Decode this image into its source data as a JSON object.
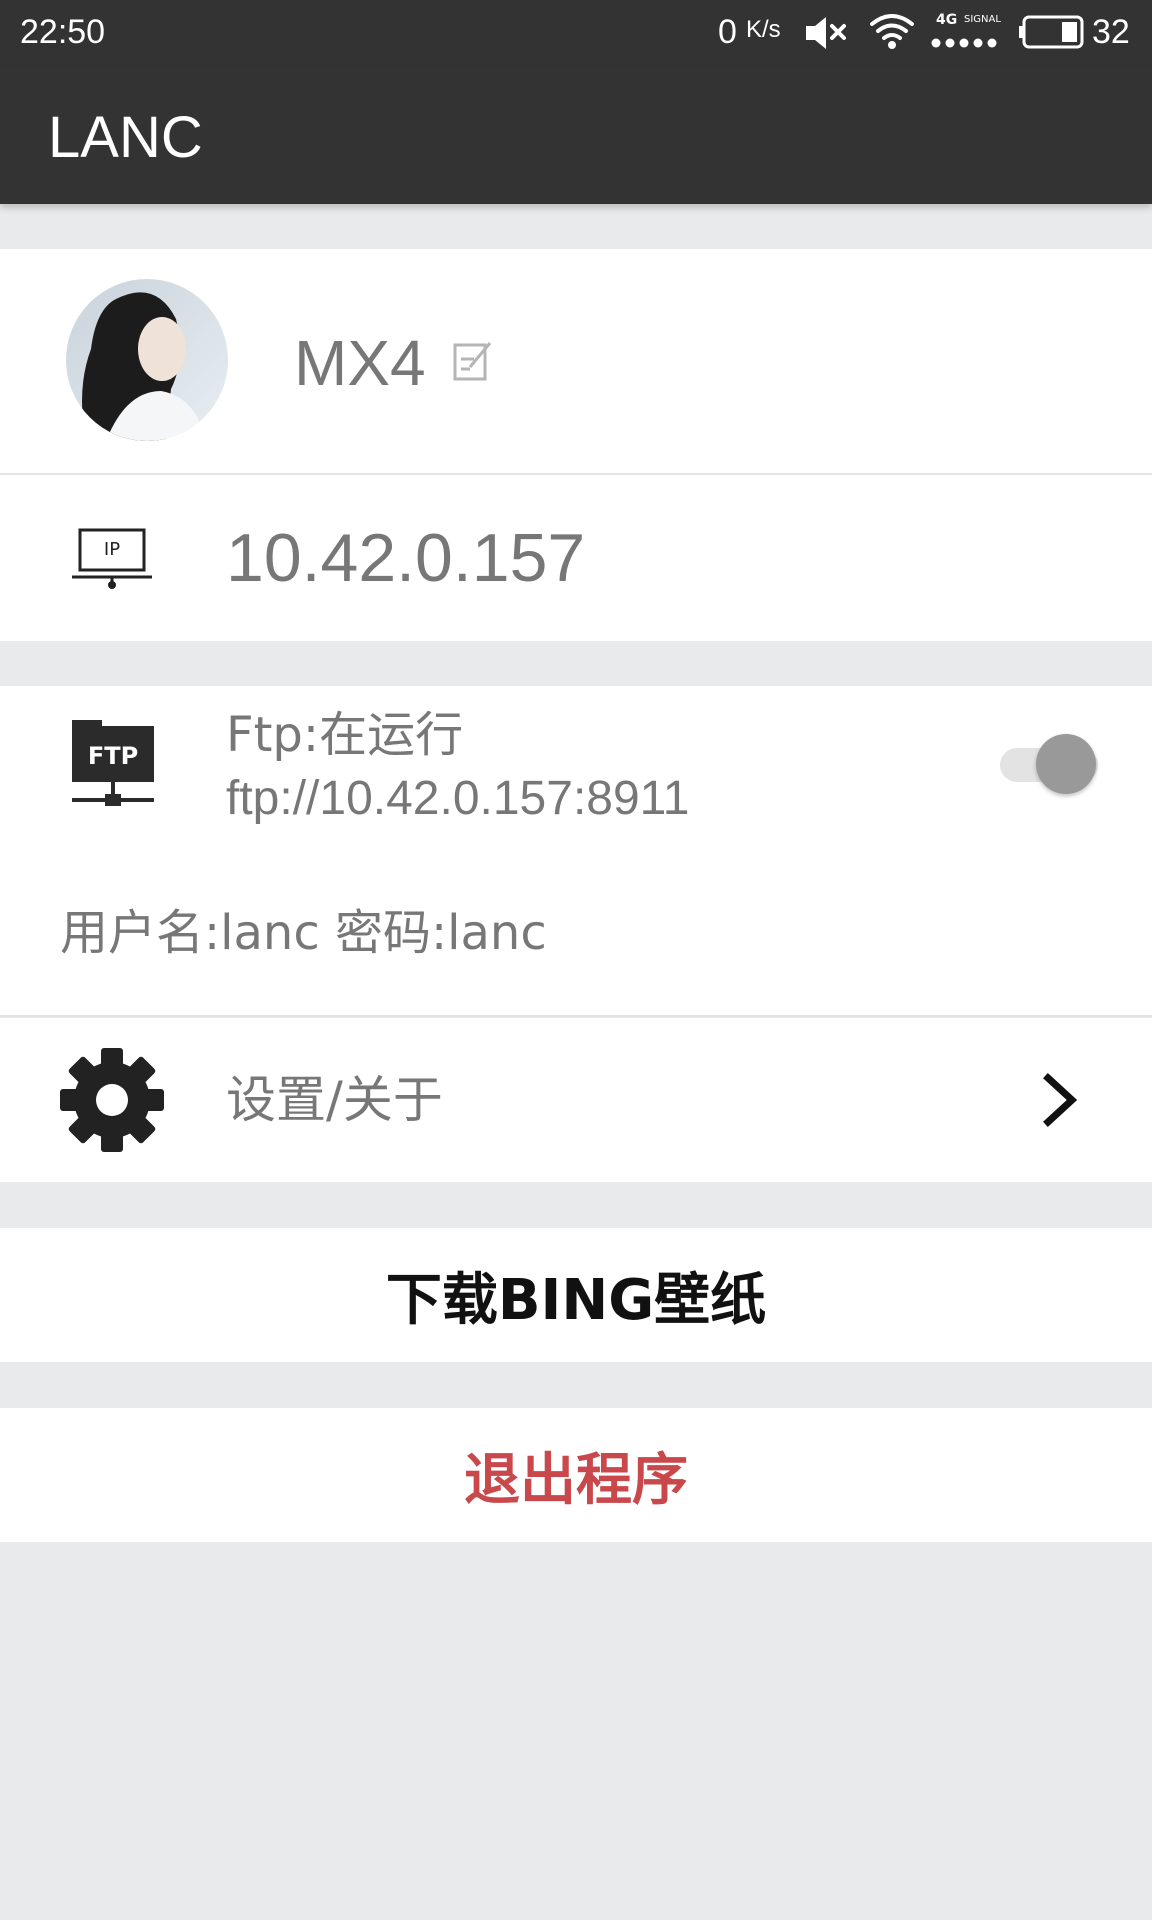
{
  "status_bar": {
    "time": "22:50",
    "net_speed_value": "0",
    "net_speed_unit": "K/s",
    "network_label": "4G",
    "signal_label": "SIGNAL",
    "battery_level": "32"
  },
  "app_bar": {
    "title": "LANC"
  },
  "profile": {
    "device_name": "MX4"
  },
  "ip_row": {
    "ip": "10.42.0.157"
  },
  "ftp": {
    "icon_label": "FTP",
    "status": "Ftp:在运行",
    "url": "ftp://10.42.0.157:8911",
    "credentials": "用户名:lanc 密码:lanc",
    "enabled": true
  },
  "settings": {
    "label": "设置/关于"
  },
  "actions": {
    "download_label": "下载BING壁纸",
    "exit_label": "退出程序"
  },
  "colors": {
    "bar_background": "#333333",
    "page_background": "#e9eaec",
    "exit_red": "#c9484b",
    "secondary_text": "#777777"
  }
}
